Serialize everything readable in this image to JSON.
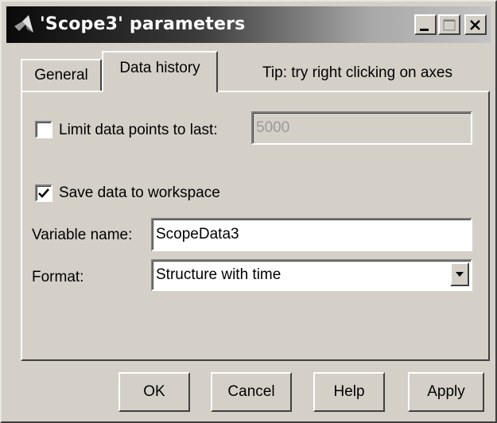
{
  "window": {
    "title": "'Scope3' parameters"
  },
  "titlebar_buttons": {
    "minimize_icon": "minimize-icon",
    "maximize_icon": "maximize-icon",
    "close_icon": "close-icon"
  },
  "tabs": [
    {
      "label": "General",
      "selected": false
    },
    {
      "label": "Data history",
      "selected": true
    }
  ],
  "tip": "Tip: try right clicking on axes",
  "limit_points": {
    "label": "Limit data points to last:",
    "checked": false,
    "value": "5000",
    "enabled": false
  },
  "save_workspace": {
    "label": "Save data to workspace",
    "checked": true
  },
  "variable_name": {
    "label": "Variable name:",
    "value": "ScopeData3"
  },
  "format": {
    "label": "Format:",
    "selected": "Structure with time"
  },
  "buttons": {
    "ok": "OK",
    "cancel": "Cancel",
    "help": "Help",
    "apply": "Apply"
  }
}
